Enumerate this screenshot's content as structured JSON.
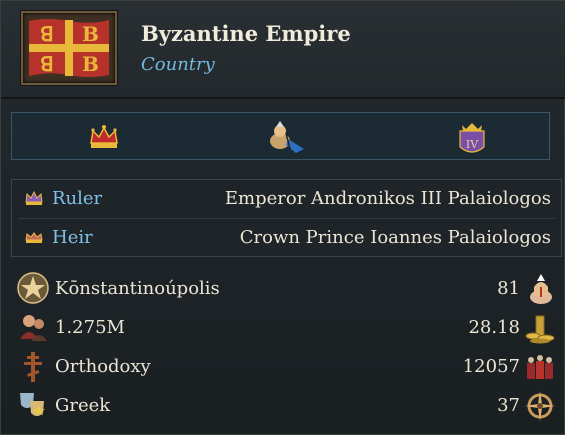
{
  "header": {
    "title": "Byzantine Empire",
    "subtitle": "Country",
    "flag_icon": "byzantine-flag-icon",
    "colors": {
      "flag_red": "#b8322c",
      "flag_gold": "#e8b83a",
      "subtitle": "#74b8e0"
    }
  },
  "icon_bar": [
    {
      "icon": "crown-icon"
    },
    {
      "icon": "diplomat-icon"
    },
    {
      "icon": "rank-iv-icon",
      "text": "IV"
    }
  ],
  "ruler": {
    "label": "Ruler",
    "value": "Emperor Andronikos III Palaiologos",
    "icon": "ruler-crown-icon"
  },
  "heir": {
    "label": "Heir",
    "value": "Crown Prince Ioannes Palaiologos",
    "icon": "heir-crown-icon"
  },
  "stats": [
    {
      "label": "Kōnstantinoúpolis",
      "value": "81",
      "icon": "capital-star-icon",
      "right_icon": "clergy-icon"
    },
    {
      "label": "1.275M",
      "value": "28.18",
      "icon": "population-icon",
      "right_icon": "gold-coins-icon"
    },
    {
      "label": "Orthodoxy",
      "value": "12057",
      "icon": "orthodox-cross-icon",
      "right_icon": "army-icon"
    },
    {
      "label": "Greek",
      "value": "37",
      "icon": "culture-masks-icon",
      "right_icon": "compass-icon"
    }
  ]
}
